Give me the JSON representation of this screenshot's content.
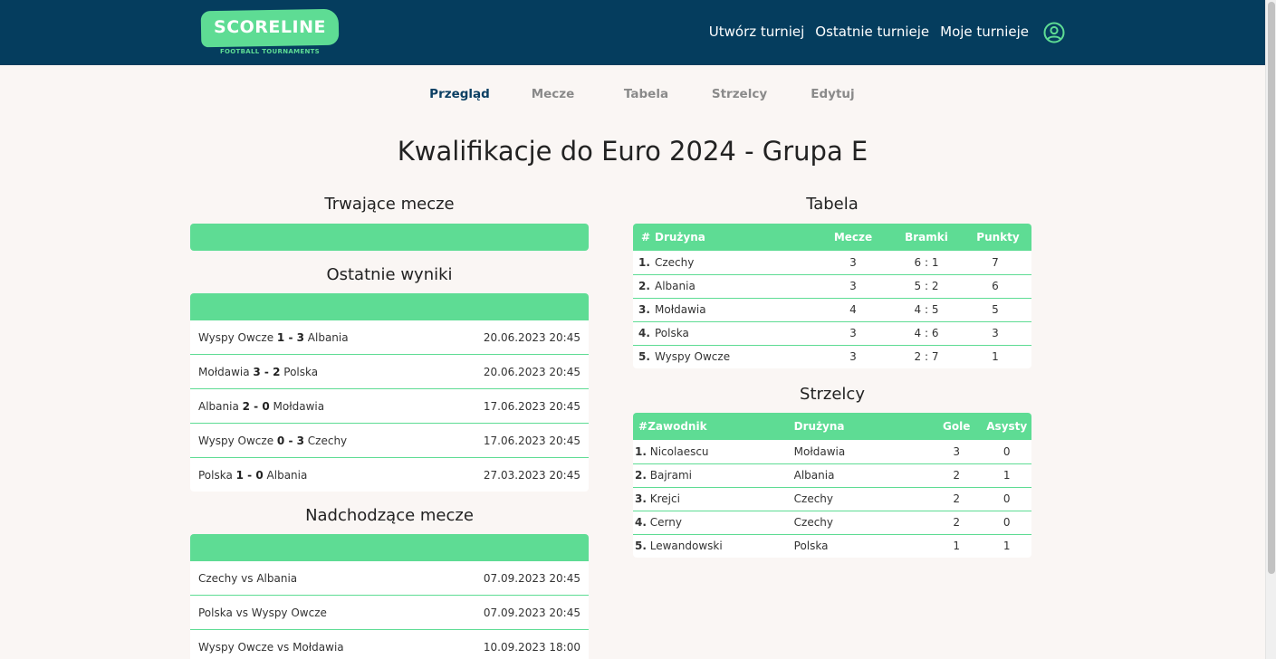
{
  "brand": {
    "name": "SCORELINE",
    "tagline": "Football Tournaments"
  },
  "nav": {
    "links": [
      "Utwórz turniej",
      "Ostatnie turnieje",
      "Moje turnieje"
    ]
  },
  "tabs": [
    {
      "label": "Przegląd",
      "active": true
    },
    {
      "label": "Mecze",
      "active": false
    },
    {
      "label": "Tabela",
      "active": false
    },
    {
      "label": "Strzelcy",
      "active": false
    },
    {
      "label": "Edytuj",
      "active": false
    }
  ],
  "page_title": "Kwalifikacje do Euro 2024 - Grupa E",
  "ongoing": {
    "title": "Trwające mecze"
  },
  "recent": {
    "title": "Ostatnie wyniki",
    "matches": [
      {
        "home": "Wyspy Owcze",
        "score": "1 - 3",
        "away": "Albania",
        "date": "20.06.2023 20:45"
      },
      {
        "home": "Mołdawia",
        "score": "3 - 2",
        "away": "Polska",
        "date": "20.06.2023 20:45"
      },
      {
        "home": "Albania",
        "score": "2 - 0",
        "away": "Mołdawia",
        "date": "17.06.2023 20:45"
      },
      {
        "home": "Wyspy Owcze",
        "score": "0 - 3",
        "away": "Czechy",
        "date": "17.06.2023 20:45"
      },
      {
        "home": "Polska",
        "score": "1 - 0",
        "away": "Albania",
        "date": "27.03.2023 20:45"
      }
    ]
  },
  "upcoming": {
    "title": "Nadchodzące mecze",
    "matches": [
      {
        "label": "Czechy vs Albania",
        "date": "07.09.2023 20:45"
      },
      {
        "label": "Polska vs Wyspy Owcze",
        "date": "07.09.2023 20:45"
      },
      {
        "label": "Wyspy Owcze vs Mołdawia",
        "date": "10.09.2023 18:00"
      }
    ]
  },
  "standings": {
    "title": "Tabela",
    "headers": {
      "rank": "#",
      "team": "Drużyna",
      "played": "Mecze",
      "goals": "Bramki",
      "points": "Punkty"
    },
    "rows": [
      {
        "rank": "1.",
        "team": "Czechy",
        "played": "3",
        "goals": "6 : 1",
        "points": "7"
      },
      {
        "rank": "2.",
        "team": "Albania",
        "played": "3",
        "goals": "5 : 2",
        "points": "6"
      },
      {
        "rank": "3.",
        "team": "Mołdawia",
        "played": "4",
        "goals": "4 : 5",
        "points": "5"
      },
      {
        "rank": "4.",
        "team": "Polska",
        "played": "3",
        "goals": "4 : 6",
        "points": "3"
      },
      {
        "rank": "5.",
        "team": "Wyspy Owcze",
        "played": "3",
        "goals": "2 : 7",
        "points": "1"
      }
    ]
  },
  "scorers": {
    "title": "Strzelcy",
    "headers": {
      "rank": "#",
      "player": "Zawodnik",
      "team": "Drużyna",
      "goals": "Gole",
      "assists": "Asysty"
    },
    "rows": [
      {
        "rank": "1.",
        "player": "Nicolaescu",
        "team": "Mołdawia",
        "goals": "3",
        "assists": "0"
      },
      {
        "rank": "2.",
        "player": "Bajrami",
        "team": "Albania",
        "goals": "2",
        "assists": "1"
      },
      {
        "rank": "3.",
        "player": "Krejci",
        "team": "Czechy",
        "goals": "2",
        "assists": "0"
      },
      {
        "rank": "4.",
        "player": "Cerny",
        "team": "Czechy",
        "goals": "2",
        "assists": "0"
      },
      {
        "rank": "5.",
        "player": "Lewandowski",
        "team": "Polska",
        "goals": "1",
        "assists": "1"
      }
    ]
  }
}
